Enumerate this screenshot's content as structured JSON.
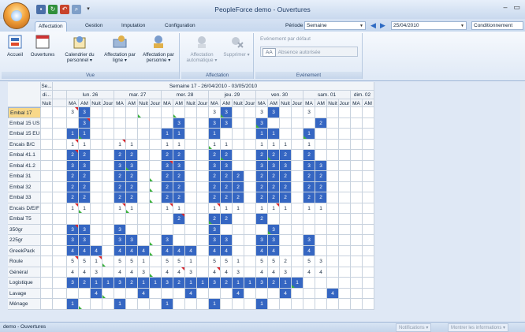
{
  "app": {
    "title": "PeopleForce demo - Ouvertures"
  },
  "window_controls": [
    "–",
    "▭"
  ],
  "tabs": [
    {
      "label": "Affectation",
      "active": true
    },
    {
      "label": "Gestion",
      "active": false
    },
    {
      "label": "Imputation",
      "active": false
    },
    {
      "label": "Configuration",
      "active": false
    }
  ],
  "period": {
    "label": "Période",
    "value": "Semaine",
    "date": "25/04/2010",
    "cond": "Conditionnement"
  },
  "ribbon": {
    "vue": {
      "name": "Vue",
      "buttons": [
        "Accueil",
        "Ouvertures",
        "Calendrier du personnel ▾",
        "Affectation par ligne ▾",
        "Affectation par personne ▾"
      ]
    },
    "affectation": {
      "name": "Affectation",
      "buttons": [
        "Affectation automatique ▾",
        "Supprimer ▾"
      ]
    },
    "evenement": {
      "name": "Evénement",
      "title": "Evénement par défaut",
      "aa": "AA",
      "value": "Absence autorisée"
    }
  },
  "grid": {
    "week_title": "Semaine 17 - 26/04/2010 - 03/05/2010",
    "left_headers": [
      "Se...",
      "di...",
      "Nuit"
    ],
    "days": [
      "lun. 26",
      "mar. 27",
      "mer. 28",
      "jeu. 29",
      "ven. 30",
      "sam. 01",
      "dim. 02"
    ],
    "shifts": [
      "MA",
      "AM",
      "Nuit",
      "Jour"
    ],
    "rows": [
      {
        "label": "Embal 17",
        "selected": true,
        "cells": [
          "3",
          "3",
          "",
          "",
          "",
          "",
          "",
          "",
          "",
          "",
          "",
          "",
          "3",
          "3",
          "",
          "",
          "3",
          "3",
          "",
          "",
          "3",
          "",
          "",
          "",
          "",
          ""
        ]
      },
      {
        "label": "Embal 15 US",
        "cells": [
          "",
          "3",
          "",
          "",
          "",
          "",
          "",
          "",
          "",
          "3",
          "",
          "",
          "3",
          "3",
          "",
          "",
          "3",
          "",
          "",
          "",
          "",
          "2",
          "",
          "",
          "",
          ""
        ]
      },
      {
        "label": "Embal 15 EU",
        "cells": [
          "1",
          "1",
          "",
          "",
          "",
          "",
          "",
          "",
          "1",
          "1",
          "",
          "",
          "1",
          "",
          "",
          "",
          "1",
          "1",
          "",
          "",
          "1",
          "",
          "",
          "",
          "",
          ""
        ]
      },
      {
        "label": "Encais B/C",
        "cells": [
          "1",
          "1",
          "",
          "",
          "1",
          "1",
          "",
          "",
          "1",
          "1",
          "",
          "",
          "1",
          "1",
          "",
          "",
          "1",
          "1",
          "1",
          "",
          "1",
          "",
          "",
          "",
          "",
          ""
        ]
      },
      {
        "label": "Embal 41.1",
        "cells": [
          "2",
          "2",
          "",
          "",
          "2",
          "2",
          "",
          "",
          "2",
          "2",
          "",
          "",
          "2",
          "2",
          "",
          "",
          "2",
          "2",
          "2",
          "",
          "2",
          "",
          "",
          "",
          "",
          ""
        ]
      },
      {
        "label": "Embal 41.2",
        "cells": [
          "3",
          "3",
          "",
          "",
          "3",
          "3",
          "",
          "",
          "3",
          "3",
          "",
          "",
          "3",
          "3",
          "",
          "",
          "3",
          "3",
          "3",
          "",
          "3",
          "3",
          "",
          "",
          "",
          ""
        ]
      },
      {
        "label": "Embal 31",
        "cells": [
          "2",
          "2",
          "",
          "",
          "2",
          "2",
          "",
          "",
          "2",
          "2",
          "",
          "",
          "2",
          "2",
          "2",
          "",
          "2",
          "2",
          "2",
          "",
          "2",
          "2",
          "",
          "",
          "",
          ""
        ]
      },
      {
        "label": "Embal 32",
        "cells": [
          "2",
          "2",
          "",
          "",
          "2",
          "2",
          "",
          "",
          "2",
          "2",
          "",
          "",
          "2",
          "2",
          "2",
          "",
          "2",
          "2",
          "2",
          "",
          "2",
          "2",
          "",
          "",
          "",
          ""
        ]
      },
      {
        "label": "Embal 33",
        "cells": [
          "2",
          "2",
          "",
          "",
          "2",
          "2",
          "",
          "",
          "2",
          "2",
          "",
          "",
          "2",
          "2",
          "2",
          "",
          "2",
          "2",
          "2",
          "",
          "2",
          "2",
          "",
          "",
          "",
          ""
        ]
      },
      {
        "label": "Encais D/E/F",
        "cells": [
          "1",
          "1",
          "",
          "",
          "1",
          "1",
          "",
          "",
          "1",
          "1",
          "",
          "",
          "1",
          "1",
          "1",
          "",
          "1",
          "1",
          "1",
          "",
          "1",
          "1",
          "",
          "",
          "",
          ""
        ]
      },
      {
        "label": "Embal T5",
        "cells": [
          "",
          "",
          "",
          "",
          "",
          "",
          "",
          "",
          "",
          "2",
          "",
          "",
          "2",
          "2",
          "",
          "",
          "2",
          "",
          "",
          "",
          "",
          "",
          "",
          "",
          "",
          ""
        ]
      },
      {
        "label": "350gr",
        "cells": [
          "3",
          "3",
          "",
          "",
          "3",
          "",
          "",
          "",
          "",
          "",
          "",
          "",
          "3",
          "",
          "",
          "",
          "",
          "3",
          "",
          "",
          "",
          "",
          "",
          "",
          "",
          ""
        ]
      },
      {
        "label": "225gr",
        "cells": [
          "3",
          "3",
          "",
          "",
          "3",
          "3",
          "",
          "",
          "3",
          "",
          "",
          "",
          "3",
          "3",
          "",
          "",
          "3",
          "3",
          "",
          "",
          "3",
          "",
          "",
          "",
          "",
          ""
        ]
      },
      {
        "label": "GreekPack",
        "cells": [
          "4",
          "4",
          "4",
          "",
          "4",
          "4",
          "4",
          "",
          "4",
          "4",
          "4",
          "",
          "4",
          "4",
          "",
          "",
          "4",
          "4",
          "",
          "",
          "4",
          "",
          "",
          "",
          "",
          ""
        ]
      },
      {
        "label": "Roule",
        "cells": [
          "5",
          "5",
          "1",
          "",
          "5",
          "5",
          "1",
          "",
          "5",
          "5",
          "1",
          "",
          "5",
          "5",
          "1",
          "",
          "5",
          "5",
          "2",
          "",
          "5",
          "3",
          "",
          "",
          "",
          ""
        ]
      },
      {
        "label": "Général",
        "cells": [
          "4",
          "4",
          "3",
          "",
          "4",
          "4",
          "3",
          "",
          "4",
          "4",
          "3",
          "",
          "4",
          "4",
          "3",
          "",
          "4",
          "4",
          "3",
          "",
          "4",
          "4",
          "",
          "",
          "",
          ""
        ]
      },
      {
        "label": "Logistique",
        "cells": [
          "3",
          "2",
          "1",
          "1",
          "3",
          "2",
          "1",
          "1",
          "3",
          "2",
          "1",
          "1",
          "3",
          "2",
          "1",
          "1",
          "3",
          "2",
          "1",
          "1",
          "",
          "",
          "",
          "",
          "",
          ""
        ]
      },
      {
        "label": "Lavage",
        "cells": [
          "",
          "",
          "4",
          "",
          "",
          "",
          "4",
          "",
          "",
          "",
          "4",
          "",
          "",
          "",
          "4",
          "",
          "",
          "",
          "4",
          "",
          "",
          "",
          "4",
          "",
          "",
          ""
        ]
      },
      {
        "label": "Ménage",
        "cells": [
          "1",
          "",
          "",
          "",
          "1",
          "",
          "",
          "",
          "1",
          "",
          "",
          "",
          "1",
          "",
          "",
          "",
          "1",
          "",
          "",
          "",
          "",
          "",
          "",
          "",
          "",
          ""
        ]
      }
    ]
  },
  "status": {
    "text": "demo - Ouvertures",
    "btn1": "Notifications ▾",
    "btn2": "Montrer les informations ▾"
  }
}
